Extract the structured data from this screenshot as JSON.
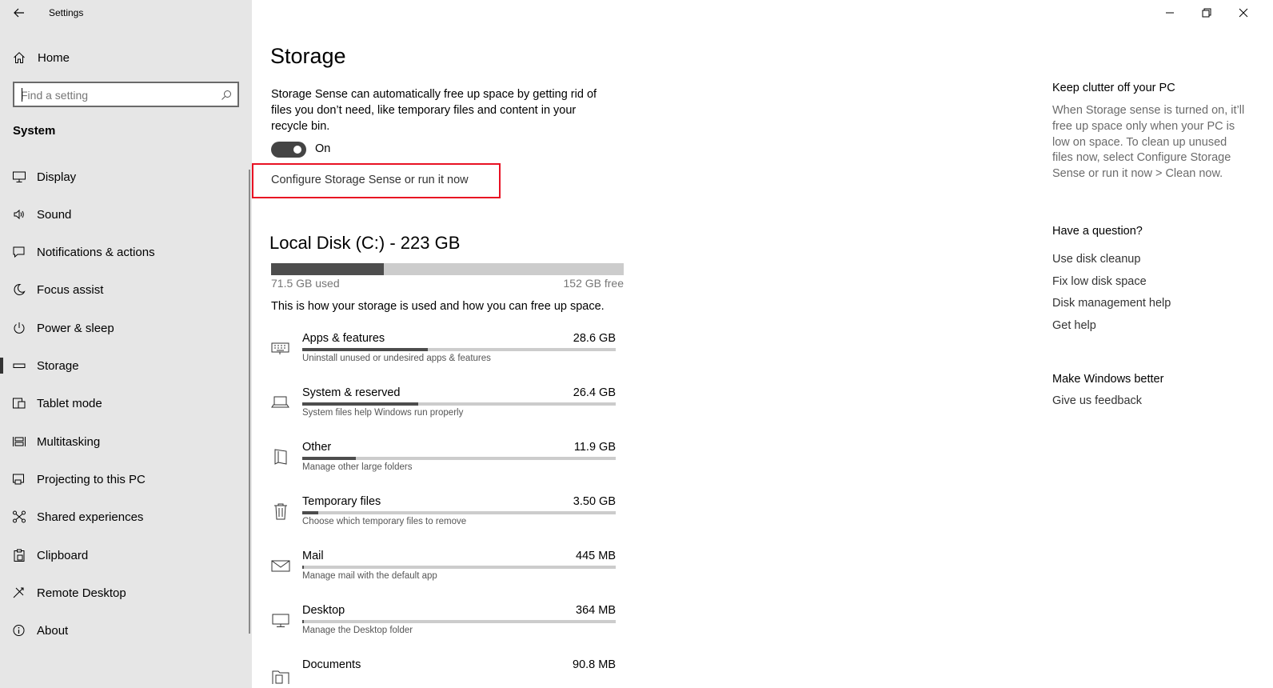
{
  "window": {
    "title": "Settings",
    "minimize_glyph": "minimize-icon",
    "restore_glyph": "restore-icon",
    "close_glyph": "close-icon"
  },
  "sidebar": {
    "home_label": "Home",
    "search_placeholder": "Find a setting",
    "section": "System",
    "items": [
      {
        "label": "Display",
        "icon": "display-icon"
      },
      {
        "label": "Sound",
        "icon": "sound-icon"
      },
      {
        "label": "Notifications & actions",
        "icon": "notifications-icon"
      },
      {
        "label": "Focus assist",
        "icon": "focus-assist-icon"
      },
      {
        "label": "Power & sleep",
        "icon": "power-icon"
      },
      {
        "label": "Storage",
        "icon": "storage-icon",
        "selected": true
      },
      {
        "label": "Tablet mode",
        "icon": "tablet-mode-icon"
      },
      {
        "label": "Multitasking",
        "icon": "multitasking-icon"
      },
      {
        "label": "Projecting to this PC",
        "icon": "projecting-icon"
      },
      {
        "label": "Shared experiences",
        "icon": "shared-experiences-icon"
      },
      {
        "label": "Clipboard",
        "icon": "clipboard-icon"
      },
      {
        "label": "Remote Desktop",
        "icon": "remote-desktop-icon"
      },
      {
        "label": "About",
        "icon": "about-icon"
      }
    ]
  },
  "main": {
    "title": "Storage",
    "sense_description": "Storage Sense can automatically free up space by getting rid of files you don’t need, like temporary files and content in your recycle bin.",
    "toggle_state": "On",
    "configure_link": "Configure Storage Sense or run it now",
    "disk": {
      "title": "Local Disk (C:) - 223 GB",
      "used": "71.5 GB used",
      "free": "152 GB free",
      "used_fraction": 0.32
    },
    "usage_description": "This is how your storage is used and how you can free up space.",
    "categories": [
      {
        "name": "Apps & features",
        "size": "28.6 GB",
        "sub": "Uninstall unused or undesired apps & features",
        "fraction": 0.4,
        "icon": "apps-icon"
      },
      {
        "name": "System & reserved",
        "size": "26.4 GB",
        "sub": "System files help Windows run properly",
        "fraction": 0.37,
        "icon": "laptop-icon"
      },
      {
        "name": "Other",
        "size": "11.9 GB",
        "sub": "Manage other large folders",
        "fraction": 0.17,
        "icon": "other-icon"
      },
      {
        "name": "Temporary files",
        "size": "3.50 GB",
        "sub": "Choose which temporary files to remove",
        "fraction": 0.05,
        "icon": "trash-icon"
      },
      {
        "name": "Mail",
        "size": "445 MB",
        "sub": "Manage mail with the default app",
        "fraction": 0.006,
        "icon": "mail-icon"
      },
      {
        "name": "Desktop",
        "size": "364 MB",
        "sub": "Manage the Desktop folder",
        "fraction": 0.005,
        "icon": "desktop-icon"
      },
      {
        "name": "Documents",
        "size": "90.8 MB",
        "sub": "",
        "fraction": 0.002,
        "icon": "documents-icon"
      }
    ]
  },
  "right_panel": {
    "clutter_heading": "Keep clutter off your PC",
    "clutter_text": "When Storage sense is turned on, it’ll free up space only when your PC is low on space. To clean up unused files now, select Configure Storage Sense or run it now > Clean now.",
    "question_heading": "Have a question?",
    "links": [
      "Use disk cleanup",
      "Fix low disk space",
      "Disk management help",
      "Get help"
    ],
    "better_heading": "Make Windows better",
    "feedback_link": "Give us feedback"
  }
}
